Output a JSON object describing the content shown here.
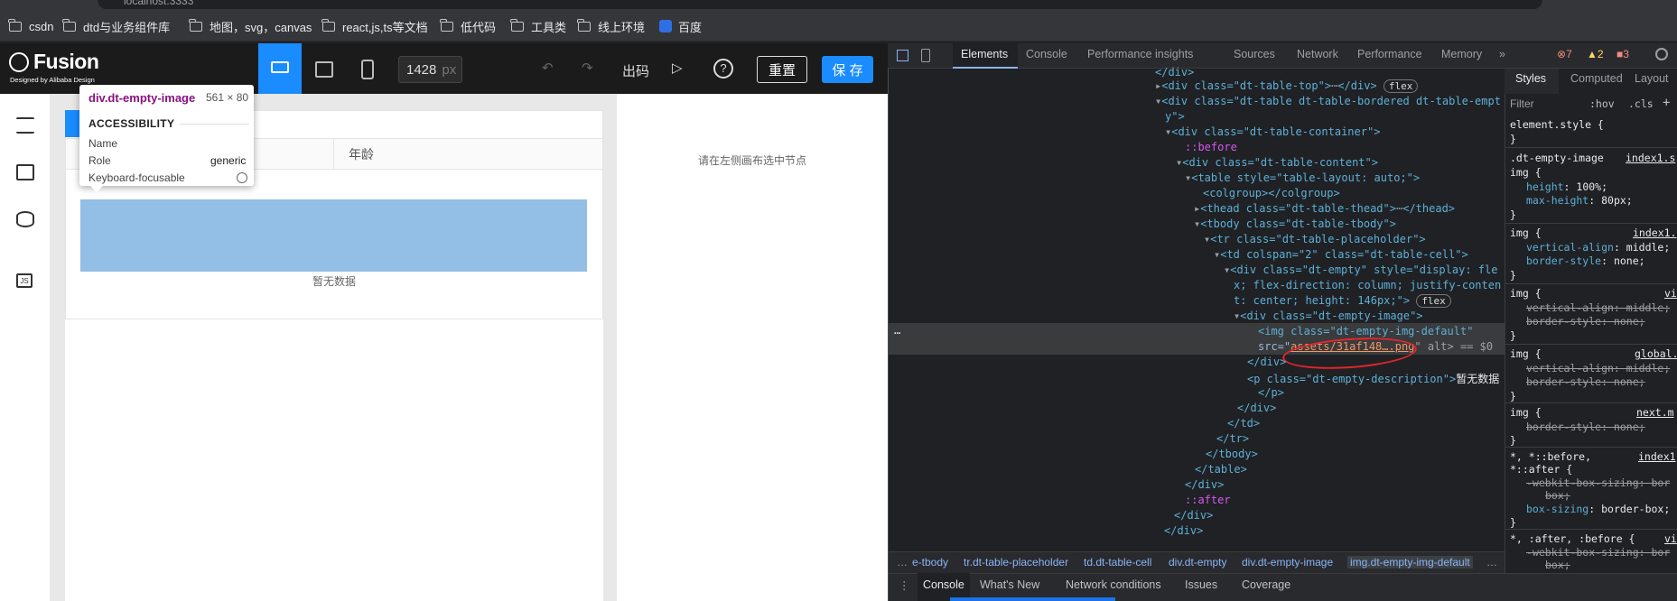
{
  "browser": {
    "url": "localhost:3333",
    "bookmarks": [
      "csdn",
      "dtd与业务组件库",
      "地图，svg，canvas",
      "react,js,ts等文档",
      "低代码",
      "工具类",
      "线上环境",
      "百度"
    ]
  },
  "app": {
    "logo_text": "Fusion",
    "logo_sub": "Designed by Alibaba Design",
    "width_value": "1428",
    "width_unit": "px",
    "code_label": "出码",
    "reset_label": "重置",
    "save_label": "保 存",
    "column_age": "年龄",
    "empty_desc": "暂无数据",
    "right_hint": "请在左侧画布选中节点"
  },
  "tooltip": {
    "selector": "div.dt-empty-image",
    "size": "561 × 80",
    "section": "ACCESSIBILITY",
    "rows": [
      {
        "label": "Name",
        "value": ""
      },
      {
        "label": "Role",
        "value": "generic"
      },
      {
        "label": "Keyboard-focusable",
        "value": ""
      }
    ]
  },
  "devtools": {
    "tabs": [
      "Elements",
      "Console",
      "Performance insights",
      "Sources",
      "Network",
      "Performance",
      "Memory"
    ],
    "errors": "7",
    "warnings": "2",
    "issues": "3",
    "style_tabs": [
      "Styles",
      "Computed",
      "Layout"
    ],
    "filter_placeholder": "Filter",
    "hov": ":hov",
    "cls": ".cls",
    "breadcrumbs": [
      "e-tbody",
      "tr.dt-table-placeholder",
      "td.dt-table-cell",
      "div.dt-empty",
      "div.dt-empty-image",
      "img.dt-empty-img-default"
    ],
    "drawer_tabs": [
      "Console",
      "What's New",
      "Network conditions",
      "Issues",
      "Coverage"
    ],
    "dom": {
      "l0": "</div>",
      "l1a": "<div class=\"dt-table-top\">",
      "l1b": "</div>",
      "l2": "<div class=\"dt-table dt-table-bordered dt-table-empt",
      "l2b": "y\">",
      "l3": "<div class=\"dt-table-container\">",
      "l4": "::before",
      "l5": "<div class=\"dt-table-content\">",
      "l6": "<table style=\"table-layout: auto;\">",
      "l7": "<colgroup></colgroup>",
      "l8a": "<thead class=\"dt-table-thead\">",
      "l8b": "</thead>",
      "l9": "<tbody class=\"dt-table-tbody\">",
      "l10": "<tr class=\"dt-table-placeholder\">",
      "l11": "<td colspan=\"2\" class=\"dt-table-cell\">",
      "l12": "<div class=\"dt-empty\" style=\"display: fle",
      "l12b": "x; flex-direction: column; justify-conten",
      "l12c": "t: center; height: 146px;\">",
      "l13": "<div class=\"dt-empty-image\">",
      "l14": "<img class=\"dt-empty-img-default\"",
      "l15a": "src=\"",
      "l15b": "assets/31af148….png",
      "l15c": "\" alt> == $0",
      "l16": "</div>",
      "l17a": "<p class=\"dt-empty-description\">",
      "l17b": "暂无数据",
      "l18": "</p>",
      "l19": "</div>",
      "l20": "</td>",
      "l21": "</tr>",
      "l22": "</tbody>",
      "l23": "</table>",
      "l24": "</div>",
      "l25": "::after",
      "l26": "</div>",
      "l27": "</div>",
      "flex": "flex"
    },
    "styles": {
      "s1": "element.style {",
      "s2": "}",
      "s3": ".dt-empty-image",
      "s3b": "index1.s",
      "s4": "img {",
      "s5a": "height",
      "s5b": "100%;",
      "s6a": "max-height",
      "s6b": "80px;",
      "s7": "}",
      "s8": "img {",
      "s8b": "index1.",
      "s9a": "vertical-align",
      "s9b": "middle;",
      "s10a": "border-style",
      "s10b": "none;",
      "s11": "}",
      "s12": "img {",
      "s12b": "vi",
      "s13": "vertical-align: middle;",
      "s14": "border-style: none;",
      "s15": "}",
      "s16": "img {",
      "s16b": "global.",
      "s17": "vertical-align: middle;",
      "s18": "border-style: none;",
      "s19": "}",
      "s20": "img {",
      "s20b": "next.m",
      "s21": "border-style: none;",
      "s22": "}",
      "s23": "*, *::before,",
      "s23b": "index1",
      "s24": "*::after {",
      "s25": "-webkit-box-sizing: bor",
      "s25b": "box;",
      "s26a": "box-sizing",
      "s26b": "border-box;",
      "s27": "}",
      "s28": "*, :after, :before {",
      "s28b": "vi",
      "s29": "-webkit-box-sizing: bor",
      "s29b": "box;"
    }
  }
}
